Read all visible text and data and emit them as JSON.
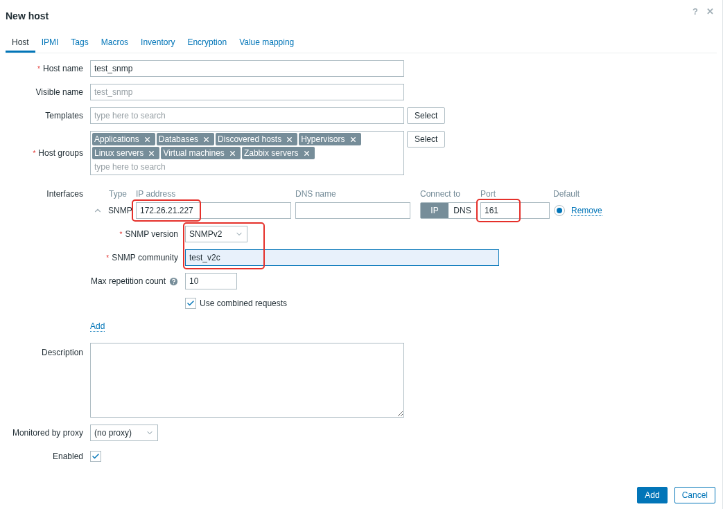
{
  "dialog": {
    "title": "New host",
    "header_buttons": [
      "?",
      "✕"
    ]
  },
  "tabs": [
    {
      "label": "Host",
      "selected": true
    },
    {
      "label": "IPMI",
      "selected": false
    },
    {
      "label": "Tags",
      "selected": false
    },
    {
      "label": "Macros",
      "selected": false
    },
    {
      "label": "Inventory",
      "selected": false
    },
    {
      "label": "Encryption",
      "selected": false
    },
    {
      "label": "Value mapping",
      "selected": false
    }
  ],
  "host_name": {
    "label": "Host name",
    "required_mark": "*",
    "value": "test_snmp"
  },
  "visible_name": {
    "label": "Visible name",
    "placeholder": "test_snmp"
  },
  "templates": {
    "label": "Templates",
    "placeholder": "type here to search",
    "button": "Select"
  },
  "host_groups": {
    "label": "Host groups",
    "required_mark": "*",
    "tags": [
      "Applications",
      "Databases",
      "Discovered hosts",
      "Hypervisors",
      "Linux servers",
      "Virtual machines",
      "Zabbix servers"
    ],
    "placeholder": "type here to search",
    "button": "Select"
  },
  "interfaces": {
    "label": "Interfaces",
    "columns": [
      "Type",
      "IP address",
      "DNS name",
      "Connect to",
      "Port",
      "Default"
    ],
    "items": [
      {
        "type": "SNMP",
        "expanded": true,
        "ip": "172.26.21.227",
        "ip_annotated": true,
        "connect_to": [
          {
            "label": "IP",
            "selected": true
          },
          {
            "label": "DNS",
            "selected": false
          }
        ],
        "port": "161",
        "port_annotated": true,
        "default": true,
        "remove": "Remove",
        "snmp_annotated": true,
        "snmp_version": {
          "label": "SNMP version",
          "required_mark": "*",
          "value": "SNMPv2"
        },
        "snmp_community": {
          "label": "SNMP community",
          "required_mark": "*",
          "value": "test_v2c",
          "focused": true
        },
        "max_repetition": {
          "label": "Max repetition count",
          "value": "10"
        },
        "combined_requests": {
          "label": "Use combined requests",
          "checked": true
        }
      }
    ],
    "add": "Add"
  },
  "description": {
    "label": "Description"
  },
  "proxy": {
    "label": "Monitored by proxy",
    "value": "(no proxy)"
  },
  "enabled": {
    "label": "Enabled",
    "checked": true
  },
  "footer_buttons": [
    {
      "label": "Add",
      "kind": "primary"
    },
    {
      "label": "Cancel",
      "kind": "secondary"
    }
  ]
}
